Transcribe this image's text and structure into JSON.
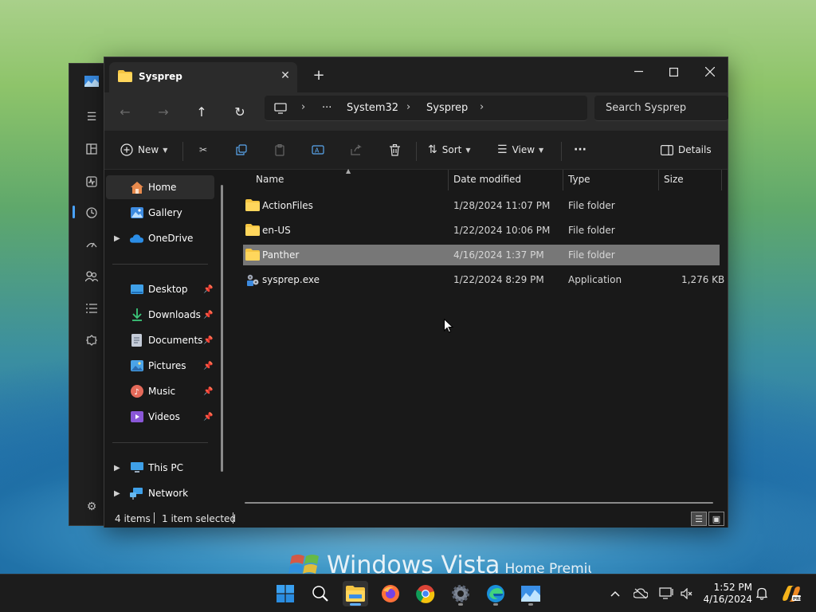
{
  "explorer": {
    "tab_title": "Sysprep",
    "breadcrumb": {
      "overflow": "···",
      "items": [
        "System32",
        "Sysprep"
      ]
    },
    "search_placeholder": "Search Sysprep",
    "commands": {
      "new": "New",
      "sort": "Sort",
      "view": "View",
      "more": "···",
      "details": "Details"
    },
    "nav": {
      "quick": [
        {
          "label": "Home",
          "icon": "home-icon",
          "selected": true
        },
        {
          "label": "Gallery",
          "icon": "gallery-icon"
        },
        {
          "label": "OneDrive",
          "icon": "cloud-icon",
          "expandable": true
        }
      ],
      "pinned": [
        {
          "label": "Desktop",
          "icon": "desktop-icon"
        },
        {
          "label": "Downloads",
          "icon": "download-icon"
        },
        {
          "label": "Documents",
          "icon": "document-icon"
        },
        {
          "label": "Pictures",
          "icon": "pictures-icon"
        },
        {
          "label": "Music",
          "icon": "music-icon"
        },
        {
          "label": "Videos",
          "icon": "videos-icon"
        }
      ],
      "locations": [
        {
          "label": "This PC",
          "icon": "pc-icon"
        },
        {
          "label": "Network",
          "icon": "network-icon"
        }
      ]
    },
    "columns": {
      "name": "Name",
      "date": "Date modified",
      "type": "Type",
      "size": "Size"
    },
    "files": [
      {
        "name": "ActionFiles",
        "date": "1/28/2024 11:07 PM",
        "type": "File folder",
        "size": "",
        "icon": "folder-icon"
      },
      {
        "name": "en-US",
        "date": "1/22/2024 10:06 PM",
        "type": "File folder",
        "size": "",
        "icon": "folder-icon"
      },
      {
        "name": "Panther",
        "date": "4/16/2024 1:37 PM",
        "type": "File folder",
        "size": "",
        "icon": "folder-icon",
        "selected": true
      },
      {
        "name": "sysprep.exe",
        "date": "1/22/2024 8:29 PM",
        "type": "Application",
        "size": "1,276 KB",
        "icon": "application-icon"
      }
    ],
    "status": {
      "items": "4 items",
      "selected": "1 item selected"
    }
  },
  "desktop": {
    "brand": "Windows Vista",
    "edition": "Home Premium"
  },
  "taskbar": {
    "time": "1:52 PM",
    "date": "4/16/2024"
  },
  "colors": {
    "accent": "#60b0ff",
    "folder": "#f5c542",
    "selection": "#777777"
  }
}
